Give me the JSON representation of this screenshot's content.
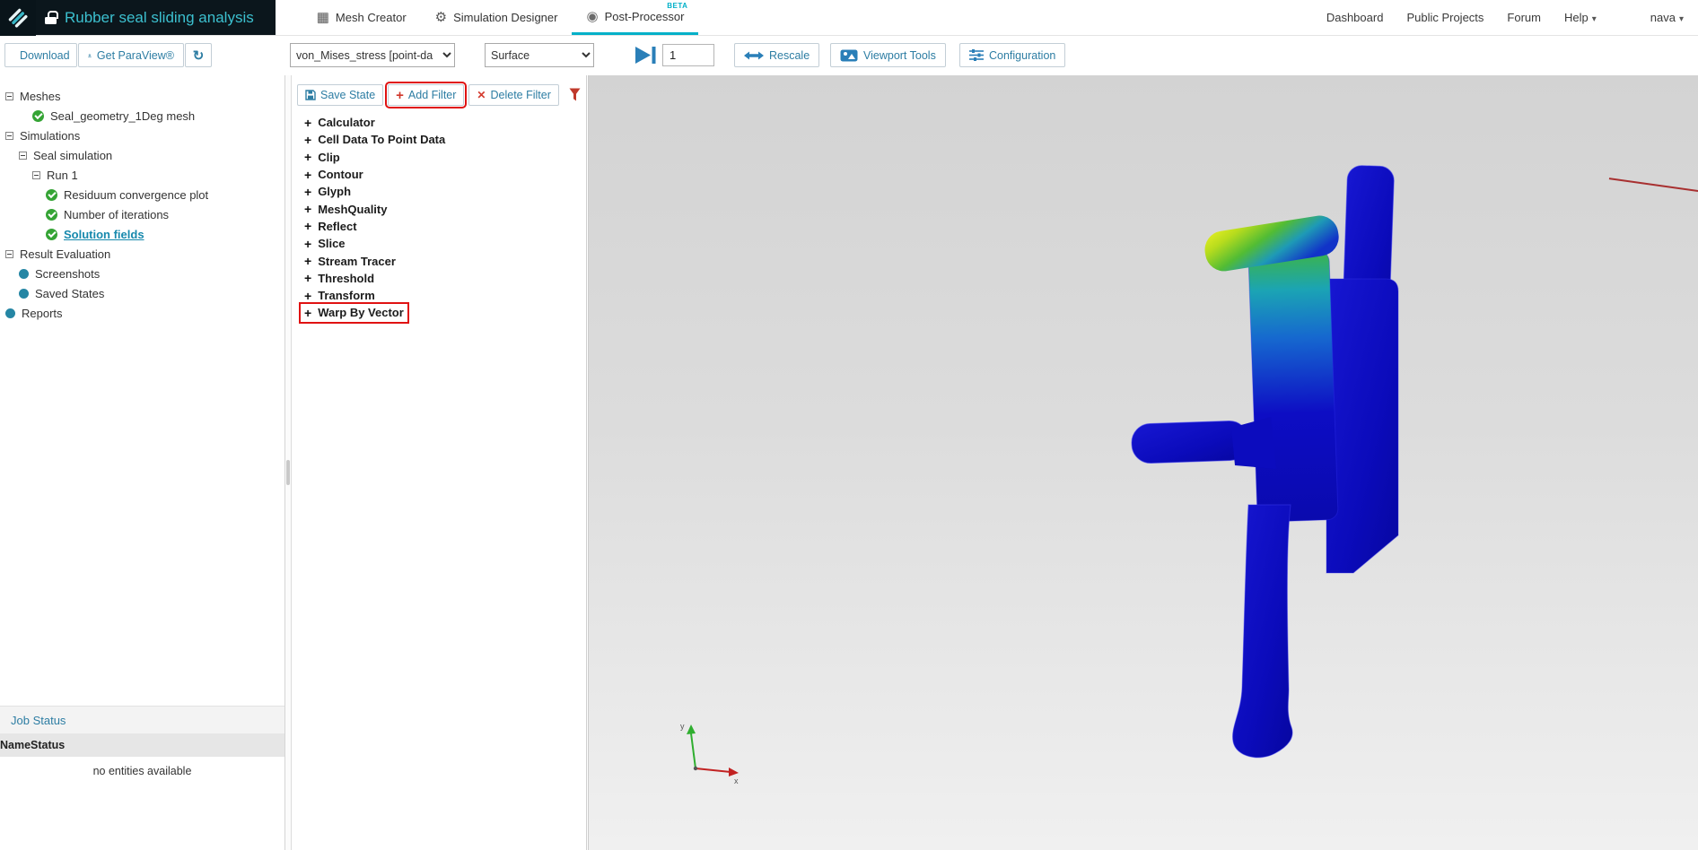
{
  "header": {
    "title": "Rubber seal sliding analysis",
    "tabs": [
      {
        "label": "Mesh Creator",
        "icon": "mesh-grid"
      },
      {
        "label": "Simulation Designer",
        "icon": "gears"
      },
      {
        "label": "Post-Processor",
        "icon": "post-processor",
        "active": true,
        "beta": "BETA"
      }
    ],
    "links": [
      "Dashboard",
      "Public Projects",
      "Forum"
    ],
    "help_label": "Help",
    "user_label": "nava"
  },
  "toolbar": {
    "download_label": "Download",
    "get_paraview_label": "Get ParaView®",
    "field_select_value": "von_Mises_stress [point-da",
    "representation_select_value": "Surface",
    "frame_value": "1",
    "rescale_label": "Rescale",
    "viewport_tools_label": "Viewport Tools",
    "configuration_label": "Configuration"
  },
  "tree": {
    "items": [
      {
        "label": "Meshes",
        "icon": "minus-box",
        "indent": 0
      },
      {
        "label": "Seal_geometry_1Deg mesh",
        "icon": "check",
        "indent": 2
      },
      {
        "label": "Simulations",
        "icon": "minus-box",
        "indent": 0
      },
      {
        "label": "Seal simulation",
        "icon": "minus-box",
        "indent": 1
      },
      {
        "label": "Run 1",
        "icon": "minus-box",
        "indent": 2
      },
      {
        "label": "Residuum convergence plot",
        "icon": "check",
        "indent": 3
      },
      {
        "label": "Number of iterations",
        "icon": "check",
        "indent": 3
      },
      {
        "label": "Solution fields",
        "icon": "check",
        "indent": 3,
        "selected": true
      },
      {
        "label": "Result Evaluation",
        "icon": "minus-box",
        "indent": 0
      },
      {
        "label": "Screenshots",
        "icon": "dot",
        "indent": 1
      },
      {
        "label": "Saved States",
        "icon": "dot",
        "indent": 1
      },
      {
        "label": "Reports",
        "icon": "dot",
        "indent": 0
      }
    ]
  },
  "job_status": {
    "title": "Job Status",
    "columns": [
      "Name",
      "Status"
    ],
    "empty_message": "no entities available"
  },
  "filter_panel": {
    "save_state_label": "Save State",
    "add_filter_label": "Add Filter",
    "delete_filter_label": "Delete Filter",
    "filters": [
      {
        "label": "Calculator"
      },
      {
        "label": "Cell Data To Point Data"
      },
      {
        "label": "Clip"
      },
      {
        "label": "Contour"
      },
      {
        "label": "Glyph"
      },
      {
        "label": "MeshQuality"
      },
      {
        "label": "Reflect"
      },
      {
        "label": "Slice"
      },
      {
        "label": "Stream Tracer"
      },
      {
        "label": "Threshold"
      },
      {
        "label": "Transform"
      },
      {
        "label": "Warp By Vector",
        "boxed": true
      }
    ]
  },
  "viewport": {
    "axis_x_label": "x",
    "axis_y_label": "y"
  },
  "colors": {
    "accent": "#00b0c8",
    "link": "#2d7da3",
    "annotation": "#e01212",
    "check_green": "#35a435",
    "node_dot": "#2586a4",
    "header_dark": "#0b161c",
    "title_teal": "#3cc0cf",
    "model_blue": "#0b0bbb",
    "model_green": "#52bc34",
    "model_yellow": "#eaf024"
  }
}
